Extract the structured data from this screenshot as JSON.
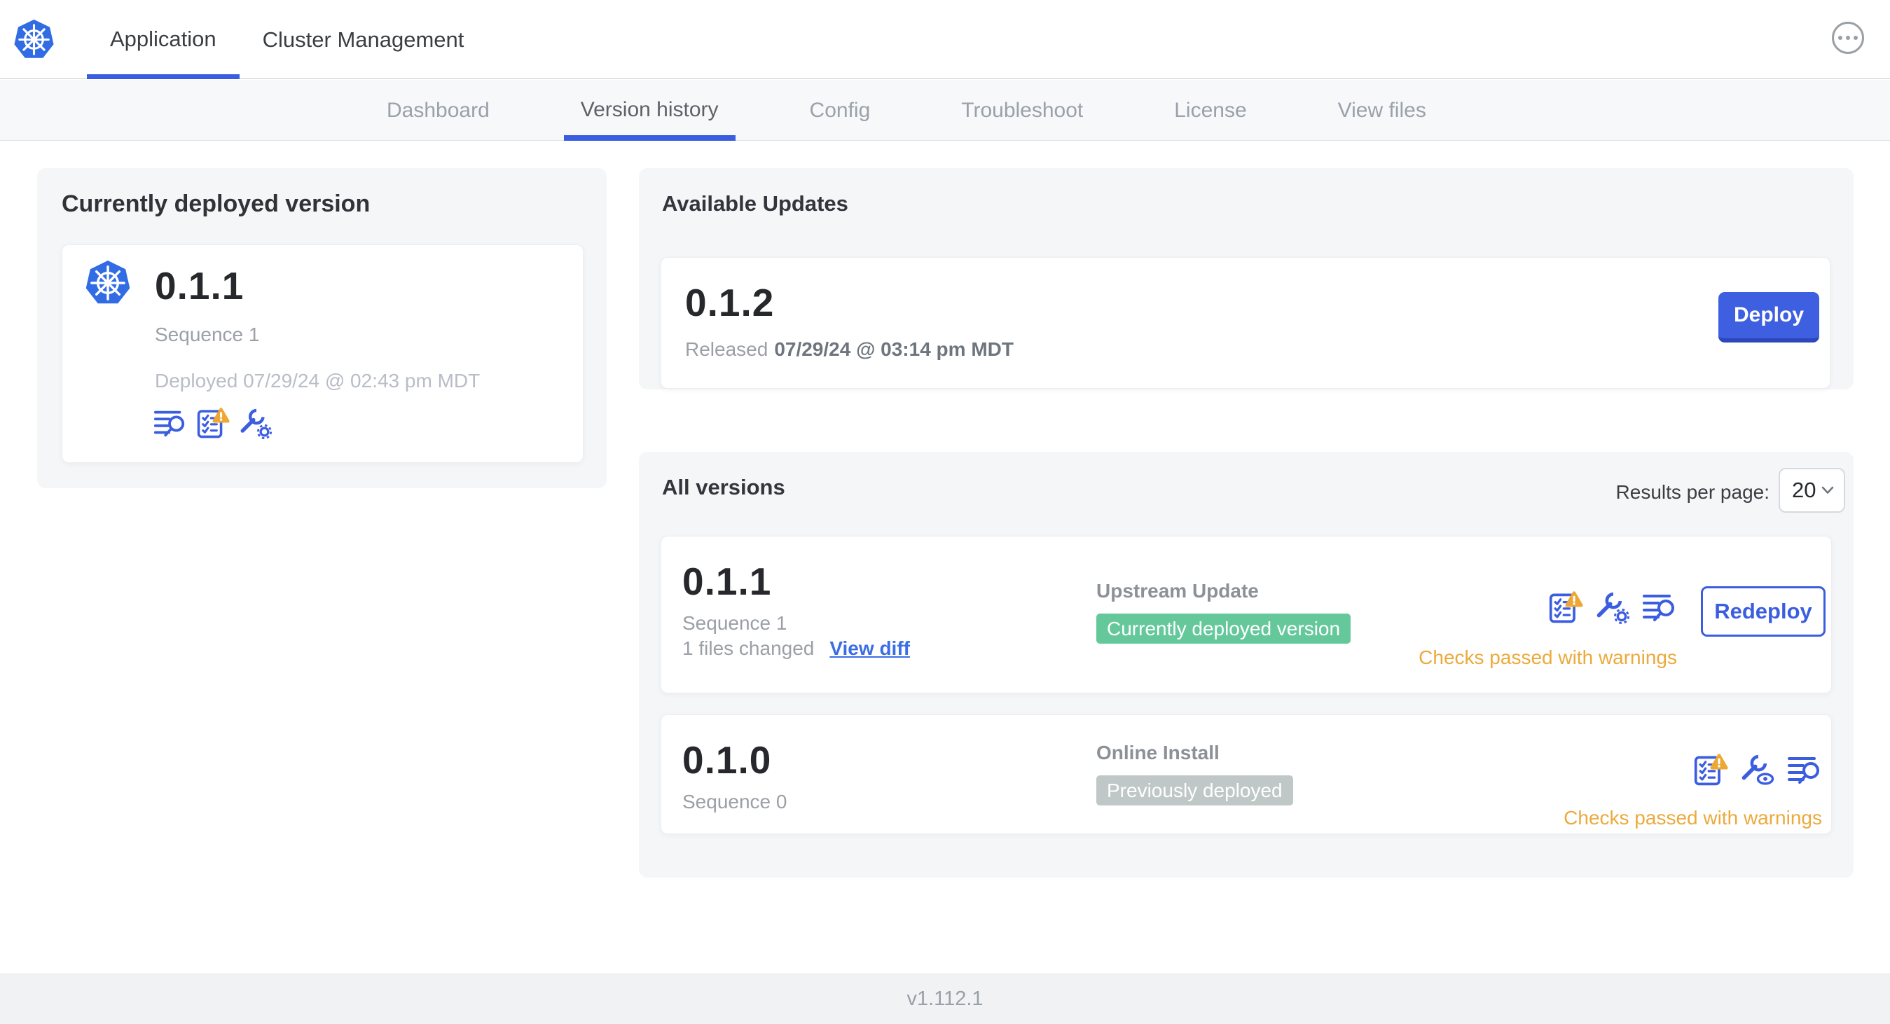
{
  "topbar": {
    "logo_icon": "kubernetes-logo-icon",
    "tabs": [
      {
        "label": "Application",
        "active": true
      },
      {
        "label": "Cluster Management",
        "active": false
      }
    ],
    "overflow_menu_icon": "ellipsis-icon"
  },
  "subnav": {
    "tabs": [
      {
        "label": "Dashboard",
        "active": false
      },
      {
        "label": "Version history",
        "active": true
      },
      {
        "label": "Config",
        "active": false
      },
      {
        "label": "Troubleshoot",
        "active": false
      },
      {
        "label": "License",
        "active": false
      },
      {
        "label": "View files",
        "active": false
      }
    ]
  },
  "deployed_card": {
    "title": "Currently deployed version",
    "app_icon": "kubernetes-logo-icon",
    "version": "0.1.1",
    "sequence": "Sequence 1",
    "deployed": "Deployed 07/29/24 @ 02:43 pm MDT",
    "icons": [
      "file-search-icon",
      "preflight-warning-icon",
      "wrench-gear-icon"
    ]
  },
  "available_updates": {
    "title": "Available Updates",
    "version": "0.1.2",
    "released_prefix": "Released",
    "released_date": "07/29/24 @ 03:14 pm MDT",
    "deploy_label": "Deploy"
  },
  "all_versions": {
    "title": "All versions",
    "results_per_page_label": "Results per page:",
    "results_per_page_value": "20",
    "rows": [
      {
        "version": "0.1.1",
        "sequence": "Sequence 1",
        "files_changed": "1 files changed",
        "view_diff_label": "View diff",
        "source": "Upstream Update",
        "badge": {
          "label": "Currently deployed version",
          "color": "#65c89b"
        },
        "icons": [
          "preflight-warning-icon",
          "wrench-gear-icon",
          "file-search-icon"
        ],
        "status": "Checks passed with warnings",
        "action_label": "Redeploy"
      },
      {
        "version": "0.1.0",
        "sequence": "Sequence 0",
        "source": "Online Install",
        "badge": {
          "label": "Previously deployed",
          "color": "#bfc8c6"
        },
        "icons": [
          "preflight-warning-icon",
          "wrench-eye-icon",
          "file-search-icon"
        ],
        "status": "Checks passed with warnings"
      }
    ]
  },
  "footer": {
    "version": "v1.112.1"
  },
  "colors": {
    "accent_blue": "#3b5de0",
    "kubernetes_blue": "#326ce5",
    "link_blue": "#3b6ee4",
    "badge_green": "#65c89b",
    "badge_gray": "#bfc8c6",
    "warning_orange": "#ebaa3c",
    "card_background": "#f5f6f8"
  }
}
